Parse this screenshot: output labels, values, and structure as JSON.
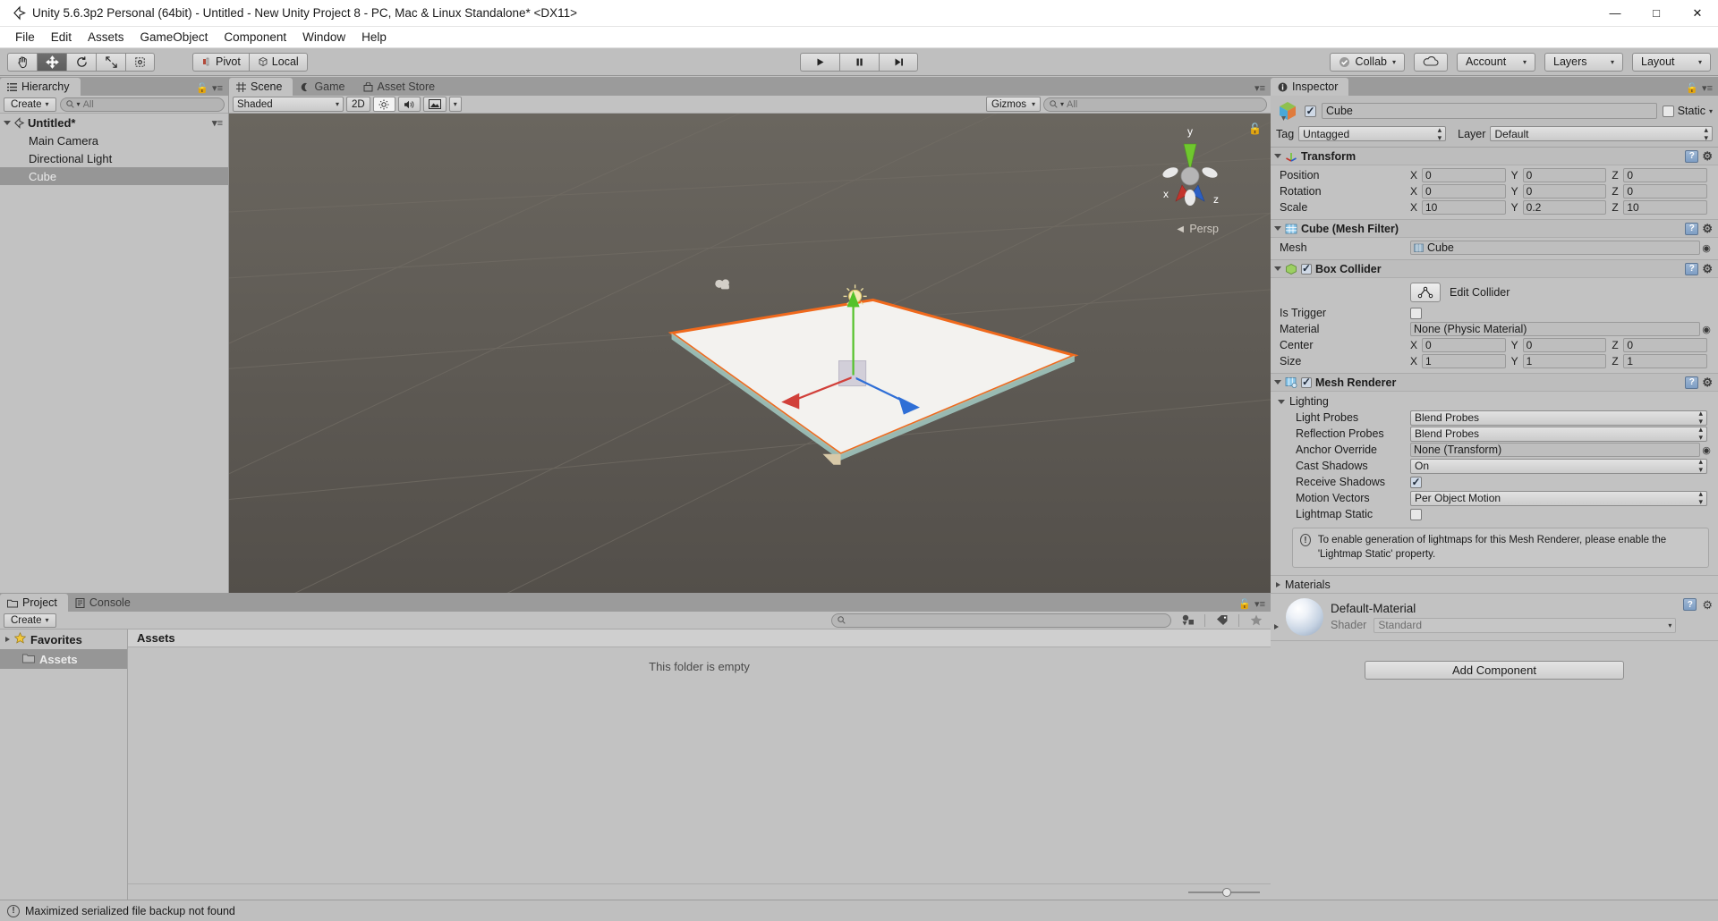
{
  "window": {
    "title": "Unity 5.6.3p2 Personal (64bit) - Untitled - New Unity Project 8 - PC, Mac & Linux Standalone* <DX11>",
    "minimize": "—",
    "maximize": "□",
    "close": "✕"
  },
  "menubar": {
    "items": [
      "File",
      "Edit",
      "Assets",
      "GameObject",
      "Component",
      "Window",
      "Help"
    ]
  },
  "toolbar": {
    "tools": [
      {
        "name": "hand-tool",
        "active": false
      },
      {
        "name": "move-tool",
        "active": true
      },
      {
        "name": "rotate-tool",
        "active": false
      },
      {
        "name": "scale-tool",
        "active": false
      },
      {
        "name": "rect-tool",
        "active": false
      }
    ],
    "pivot_label": "Pivot",
    "local_label": "Local",
    "play_label": "▶",
    "pause_label": "❙❙",
    "step_label": "▶❙",
    "collab_label": "Collab",
    "cloud_label": "☁",
    "account_label": "Account",
    "layers_label": "Layers",
    "layout_label": "Layout",
    "caret": "▾"
  },
  "hierarchy": {
    "tab_label": "Hierarchy",
    "create_label": "Create",
    "search_placeholder": "All",
    "root": "Untitled*",
    "items": [
      {
        "label": "Main Camera",
        "selected": false
      },
      {
        "label": "Directional Light",
        "selected": false
      },
      {
        "label": "Cube",
        "selected": true
      }
    ]
  },
  "scene": {
    "tabs": [
      {
        "label": "Scene",
        "active": true
      },
      {
        "label": "Game",
        "active": false
      },
      {
        "label": "Asset Store",
        "active": false
      }
    ],
    "shading_mode": "Shaded",
    "mode_2d": "2D",
    "gizmos_label": "Gizmos",
    "search_placeholder": "All",
    "axis_x": "x",
    "axis_y": "y",
    "axis_z": "z",
    "perspective_label": "Persp"
  },
  "inspector": {
    "tab_label": "Inspector",
    "object_name": "Cube",
    "object_enabled": true,
    "static_label": "Static",
    "static_checked": false,
    "tag_label": "Tag",
    "tag_value": "Untagged",
    "layer_label": "Layer",
    "layer_value": "Default",
    "transform": {
      "title": "Transform",
      "rows": [
        {
          "name": "Position",
          "x": "0",
          "y": "0",
          "z": "0"
        },
        {
          "name": "Rotation",
          "x": "0",
          "y": "0",
          "z": "0"
        },
        {
          "name": "Scale",
          "x": "10",
          "y": "0.2",
          "z": "10"
        }
      ]
    },
    "mesh_filter": {
      "title": "Cube (Mesh Filter)",
      "mesh_label": "Mesh",
      "mesh_value": "Cube"
    },
    "box_collider": {
      "title": "Box Collider",
      "enabled": true,
      "edit_collider_label": "Edit Collider",
      "is_trigger_label": "Is Trigger",
      "is_trigger_checked": false,
      "material_label": "Material",
      "material_value": "None (Physic Material)",
      "center_label": "Center",
      "center": {
        "x": "0",
        "y": "0",
        "z": "0"
      },
      "size_label": "Size",
      "size": {
        "x": "1",
        "y": "1",
        "z": "1"
      }
    },
    "mesh_renderer": {
      "title": "Mesh Renderer",
      "enabled": true,
      "lighting_label": "Lighting",
      "light_probes_label": "Light Probes",
      "light_probes_value": "Blend Probes",
      "reflection_probes_label": "Reflection Probes",
      "reflection_probes_value": "Blend Probes",
      "anchor_override_label": "Anchor Override",
      "anchor_override_value": "None (Transform)",
      "cast_shadows_label": "Cast Shadows",
      "cast_shadows_value": "On",
      "receive_shadows_label": "Receive Shadows",
      "receive_shadows_checked": true,
      "motion_vectors_label": "Motion Vectors",
      "motion_vectors_value": "Per Object Motion",
      "lightmap_static_label": "Lightmap Static",
      "lightmap_static_checked": false,
      "info_message": "To enable generation of lightmaps for this Mesh Renderer, please enable the 'Lightmap Static' property.",
      "materials_label": "Materials"
    },
    "material": {
      "name": "Default-Material",
      "shader_label": "Shader",
      "shader_value": "Standard"
    },
    "add_component_label": "Add Component"
  },
  "project": {
    "tabs": [
      {
        "label": "Project",
        "active": true
      },
      {
        "label": "Console",
        "active": false
      }
    ],
    "create_label": "Create",
    "search_placeholder": "",
    "tree": [
      {
        "label": "Favorites",
        "selected": false,
        "icon": "star-icon"
      },
      {
        "label": "Assets",
        "selected": true,
        "icon": "folder-icon"
      }
    ],
    "content_header": "Assets",
    "empty_message": "This folder is empty"
  },
  "statusbar": {
    "message": "Maximized serialized file backup not found"
  }
}
